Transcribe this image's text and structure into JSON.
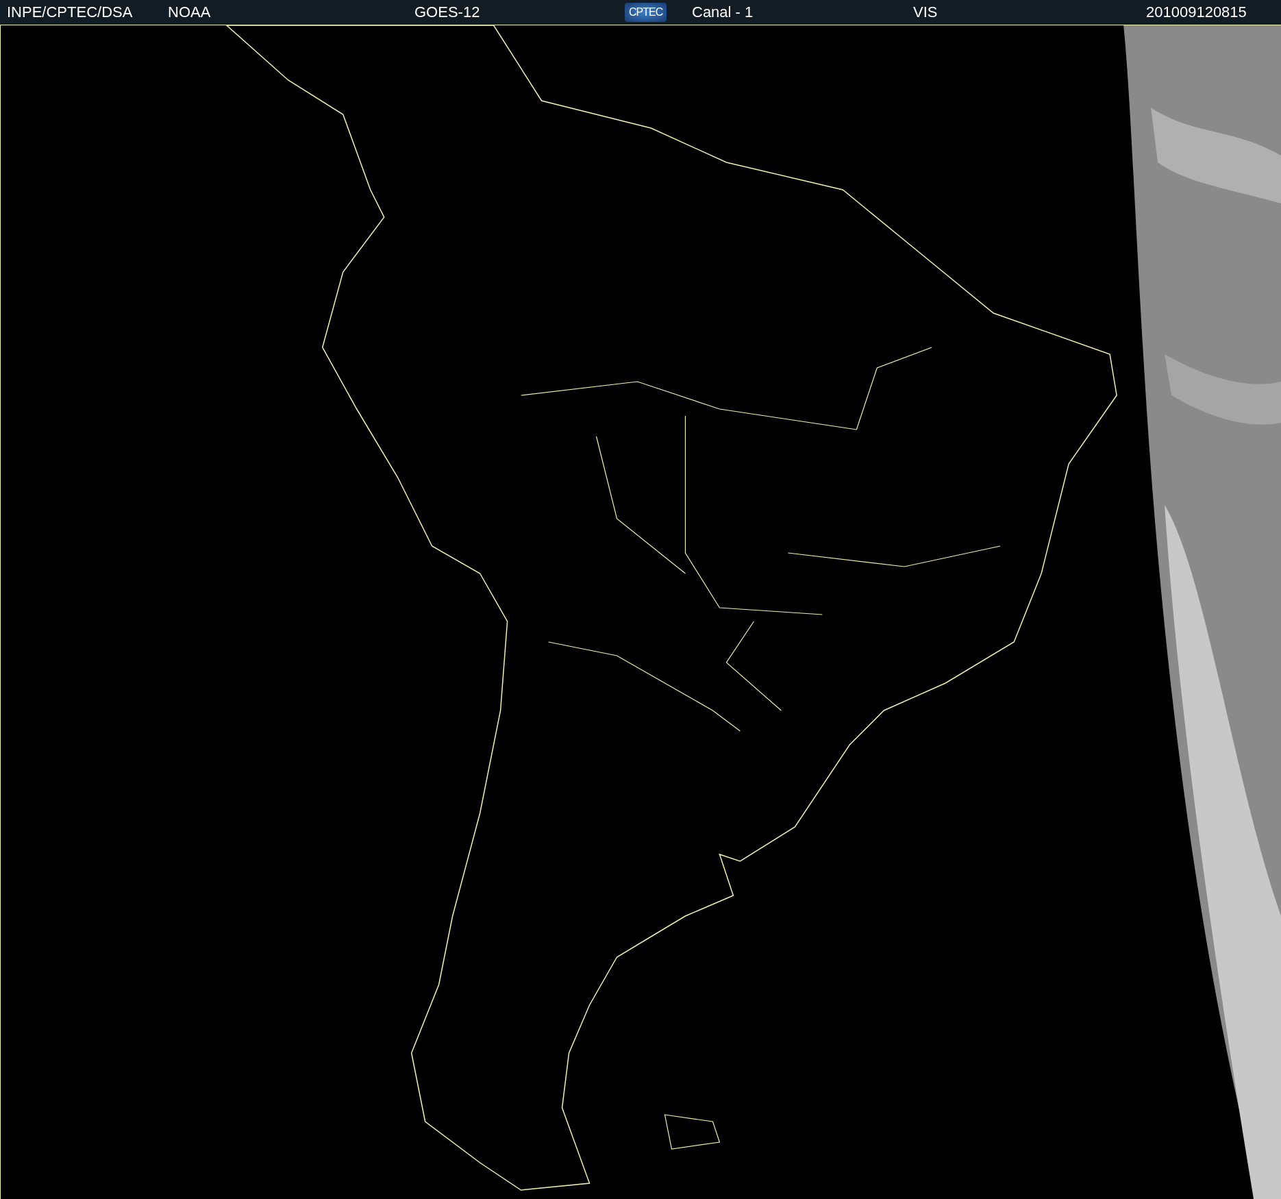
{
  "header": {
    "items": [
      {
        "kind": "text",
        "text": "INPE/CPTEC/DSA"
      },
      {
        "kind": "text",
        "text": "NOAA"
      },
      {
        "kind": "text",
        "text": "GOES-12"
      },
      {
        "kind": "logo",
        "text": "CPTEC"
      },
      {
        "kind": "text",
        "text": "Canal - 1"
      },
      {
        "kind": "text",
        "text": "VIS"
      },
      {
        "kind": "text",
        "text": "201009120815"
      }
    ]
  }
}
